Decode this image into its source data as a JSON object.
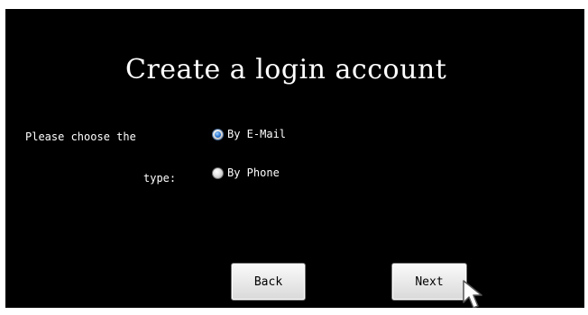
{
  "title": "Create a login account",
  "prompt": {
    "line1": "Please choose the",
    "line2": "type:"
  },
  "options": [
    {
      "label": "By E-Mail",
      "checked": true
    },
    {
      "label": "By Phone",
      "checked": false
    }
  ],
  "buttons": {
    "back_label": "Back",
    "next_label": "Next"
  },
  "icons": {
    "cursor": "mouse-pointer-icon",
    "radio_selected": "radio-checked-icon",
    "radio_unselected": "radio-unchecked-icon"
  },
  "colors": {
    "background": "#000000",
    "text": "#ffffff",
    "radio_accent": "#2b78d6",
    "button_face": "#e8e8e8"
  }
}
